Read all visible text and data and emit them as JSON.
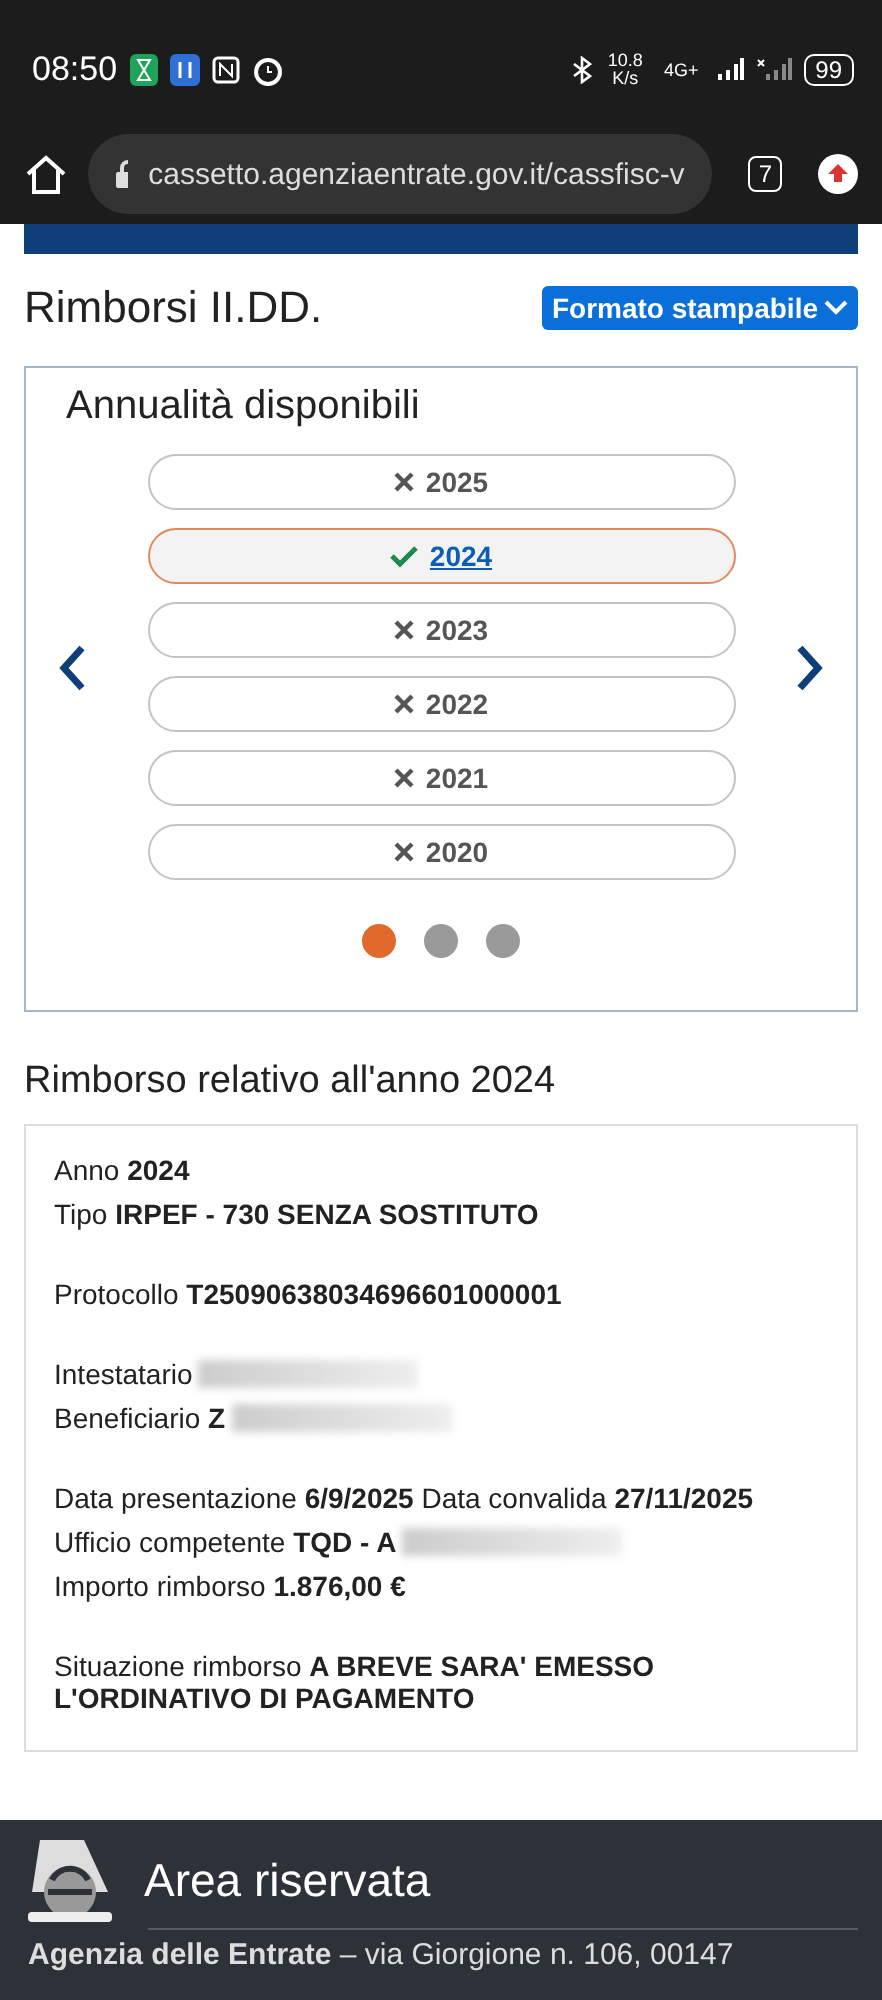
{
  "status_bar": {
    "time": "08:50",
    "net_speed": "10.8 K/s",
    "network": "4G+",
    "battery": "99"
  },
  "browser": {
    "url": "cassetto.agenziaentrate.gov.it/cassfisc-v",
    "tab_count": "7"
  },
  "page": {
    "title": "Rimborsi II.DD.",
    "print_button": "Formato stampabile"
  },
  "years_card": {
    "heading": "Annualità disponibili",
    "years": [
      {
        "label": "2025",
        "selected": false
      },
      {
        "label": "2024",
        "selected": true
      },
      {
        "label": "2023",
        "selected": false
      },
      {
        "label": "2022",
        "selected": false
      },
      {
        "label": "2021",
        "selected": false
      },
      {
        "label": "2020",
        "selected": false
      }
    ],
    "dots": [
      {
        "selected": true
      },
      {
        "selected": false
      },
      {
        "selected": false
      }
    ]
  },
  "refund": {
    "heading": "Rimborso relativo all'anno 2024",
    "groups": [
      [
        {
          "text": "Anno **2024**",
          "redacted": false
        },
        {
          "text": "Tipo **IRPEF - 730 SENZA SOSTITUTO**",
          "redacted": false
        }
      ],
      [
        {
          "text": "Protocollo **T25090638034696601000001**",
          "redacted": false
        }
      ],
      [
        {
          "text": "Intestatario",
          "redacted": true
        },
        {
          "text": "Beneficiario **Z**",
          "redacted": true
        }
      ],
      [
        {
          "text": "Data presentazione **6/9/2025** Data convalida **27/11/2025**",
          "redacted": false
        },
        {
          "text": "Ufficio competente **TQD - A**",
          "redacted": true
        },
        {
          "text": "Importo rimborso **1.876,00 €**",
          "redacted": false
        }
      ],
      [
        {
          "text": "Situazione rimborso **A BREVE SARA' EMESSO L'ORDINATIVO DI PAGAMENTO**",
          "redacted": false
        }
      ]
    ]
  },
  "footer": {
    "title": "Area riservata",
    "address": "**Agenzia delle Entrate** – via Giorgione n. 106, 00147"
  }
}
